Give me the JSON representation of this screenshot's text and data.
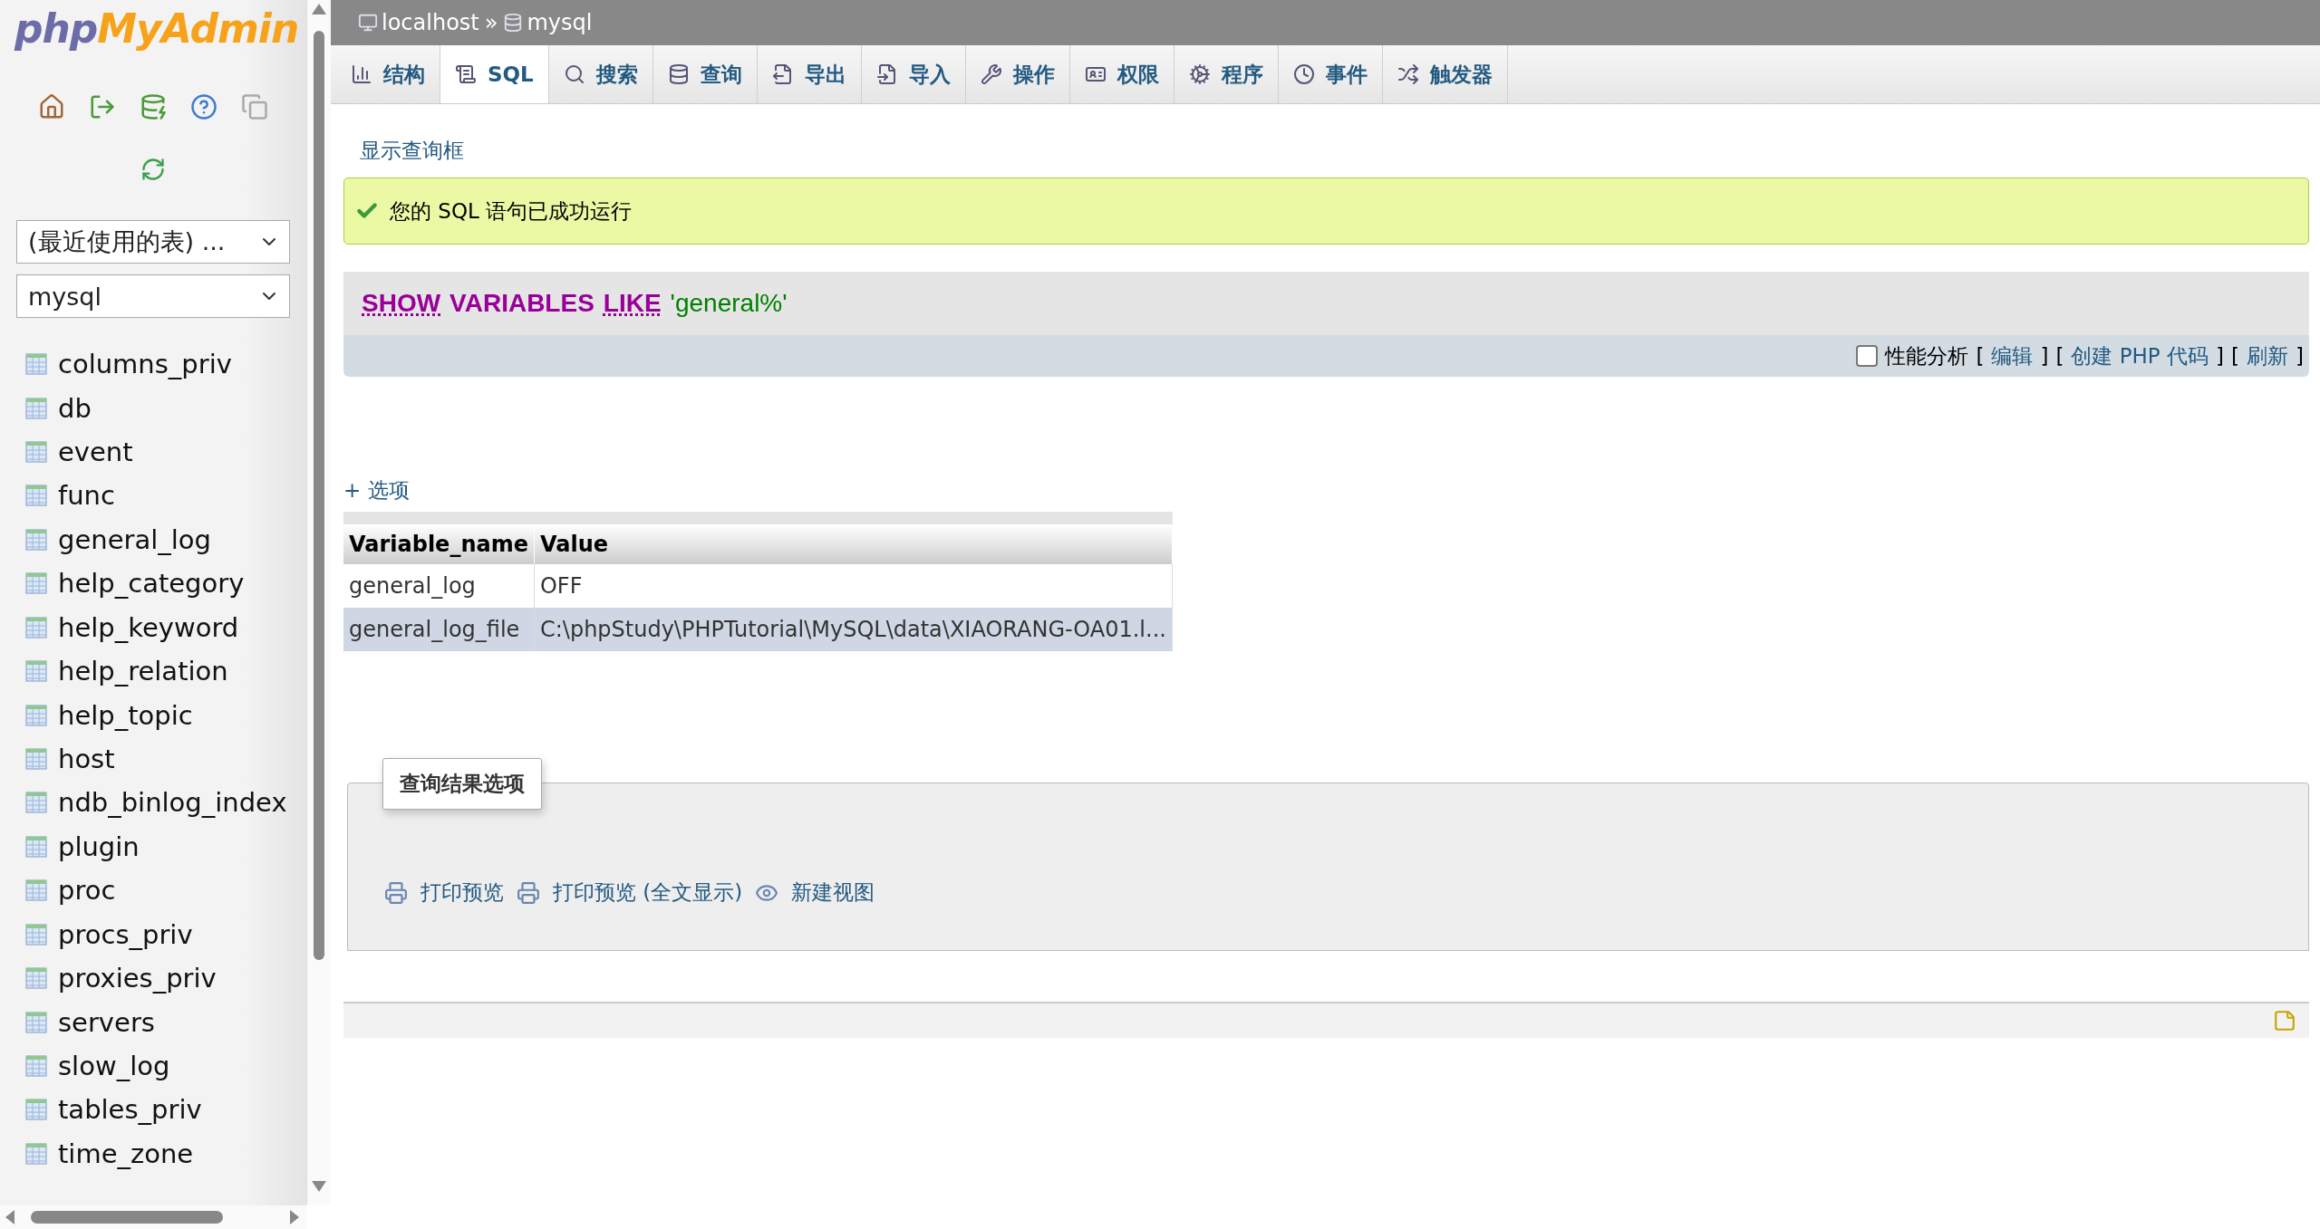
{
  "sidebar": {
    "logo": {
      "php": "php",
      "brand": "MyAdmin"
    },
    "recent_select": "(最近使用的表) ...",
    "database_select": "mysql",
    "tables": [
      "columns_priv",
      "db",
      "event",
      "func",
      "general_log",
      "help_category",
      "help_keyword",
      "help_relation",
      "help_topic",
      "host",
      "ndb_binlog_index",
      "plugin",
      "proc",
      "procs_priv",
      "proxies_priv",
      "servers",
      "slow_log",
      "tables_priv",
      "time_zone"
    ]
  },
  "breadcrumb": {
    "server": "localhost",
    "separator": "»",
    "database": "mysql"
  },
  "tabs": [
    {
      "label": "结构",
      "selected": false
    },
    {
      "label": "SQL",
      "selected": true
    },
    {
      "label": "搜索",
      "selected": false
    },
    {
      "label": "查询",
      "selected": false
    },
    {
      "label": "导出",
      "selected": false
    },
    {
      "label": "导入",
      "selected": false
    },
    {
      "label": "操作",
      "selected": false
    },
    {
      "label": "权限",
      "selected": false
    },
    {
      "label": "程序",
      "selected": false
    },
    {
      "label": "事件",
      "selected": false
    },
    {
      "label": "触发器",
      "selected": false
    }
  ],
  "show_query_link": "显示查询框",
  "success_message": "您的 SQL 语句已成功运行",
  "sql": {
    "tokens": [
      {
        "kind": "keyword",
        "text": "SHOW",
        "linked": true
      },
      {
        "kind": "keyword",
        "text": "VARIABLES",
        "linked": false
      },
      {
        "kind": "keyword",
        "text": "LIKE",
        "linked": true
      },
      {
        "kind": "string",
        "text": "'general%'",
        "linked": false
      }
    ]
  },
  "sql_actions": {
    "profiling": {
      "label": "性能分析",
      "checked": false
    },
    "links": [
      {
        "open": "[",
        "label": "编辑",
        "close": "]"
      },
      {
        "open": "[",
        "label": "创建 PHP 代码",
        "close": "]"
      },
      {
        "open": "[",
        "label": "刷新",
        "close": "]"
      }
    ]
  },
  "options_link": "+ 选项",
  "table": {
    "columns": [
      "Variable_name",
      "Value"
    ],
    "rows": [
      {
        "cells": [
          "general_log",
          "OFF"
        ],
        "selected": false
      },
      {
        "cells": [
          "general_log_file",
          "C:\\phpStudy\\PHPTutorial\\MySQL\\data\\XIAORANG-OA01.l..."
        ],
        "selected": true
      }
    ]
  },
  "result_options": {
    "legend": "查询结果选项",
    "actions": [
      "打印预览",
      "打印预览 (全文显示)",
      "新建视图"
    ]
  }
}
